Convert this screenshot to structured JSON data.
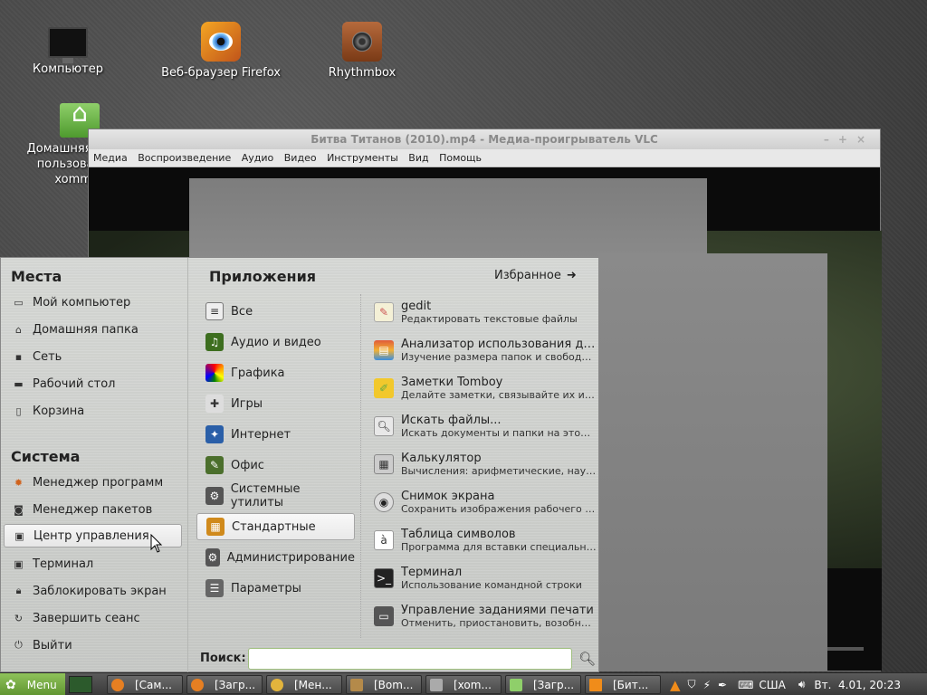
{
  "desktop": {
    "icons": [
      {
        "label": "Компьютер",
        "icon": "computer-icon"
      },
      {
        "label": "Веб-браузер Firefox",
        "icon": "firefox-icon"
      },
      {
        "label": "Rhythmbox",
        "icon": "rhythmbox-icon"
      },
      {
        "label": "Домашняя папка пользователя xommos",
        "icon": "home-folder-icon"
      }
    ]
  },
  "vlc": {
    "title": "Битва Титанов (2010).mp4 - Медиа-проигрыватель VLC",
    "menu": [
      "Медиа",
      "Воспроизведение",
      "Аудио",
      "Видео",
      "Инструменты",
      "Вид",
      "Помощь"
    ]
  },
  "menu": {
    "places_title": "Места",
    "places": [
      "Мой компьютер",
      "Домашняя папка",
      "Сеть",
      "Рабочий стол",
      "Корзина"
    ],
    "system_title": "Система",
    "system": [
      "Менеджер программ",
      "Менеджер пакетов",
      "Центр управления",
      "Терминал",
      "Заблокировать экран",
      "Завершить сеанс",
      "Выйти"
    ],
    "apps_title": "Приложения",
    "favorites": "Избранное",
    "categories": [
      "Все",
      "Аудио и видео",
      "Графика",
      "Игры",
      "Интернет",
      "Офис",
      "Системные утилиты",
      "Стандартные",
      "Администрирование",
      "Параметры"
    ],
    "apps": [
      {
        "name": "gedit",
        "desc": "Редактировать текстовые файлы"
      },
      {
        "name": "Анализатор использования дис...",
        "desc": "Изучение размера папок и свободног..."
      },
      {
        "name": "Заметки Tomboy",
        "desc": "Делайте заметки, связывайте их и ор..."
      },
      {
        "name": "Искать файлы...",
        "desc": "Искать документы и папки на этом к..."
      },
      {
        "name": "Калькулятор",
        "desc": "Вычисления: арифметические, научн..."
      },
      {
        "name": "Снимок экрана",
        "desc": "Сохранить изображения рабочего сто..."
      },
      {
        "name": "Таблица символов",
        "desc": "Программа для вставки специальных..."
      },
      {
        "name": "Терминал",
        "desc": "Использование командной строки"
      },
      {
        "name": "Управление заданиями печати",
        "desc": "Отменить, приостановить, возобнови..."
      }
    ],
    "search_label": "Поиск:",
    "search_value": ""
  },
  "taskbar": {
    "menu_label": "Menu",
    "tasks": [
      "[Сам...",
      "[Загр...",
      "[Мен...",
      "[Bom...",
      "[xom...",
      "[Загр...",
      "[Бит..."
    ],
    "keyboard_layout": "США",
    "clock": "Вт.  4.01, 20:23"
  }
}
